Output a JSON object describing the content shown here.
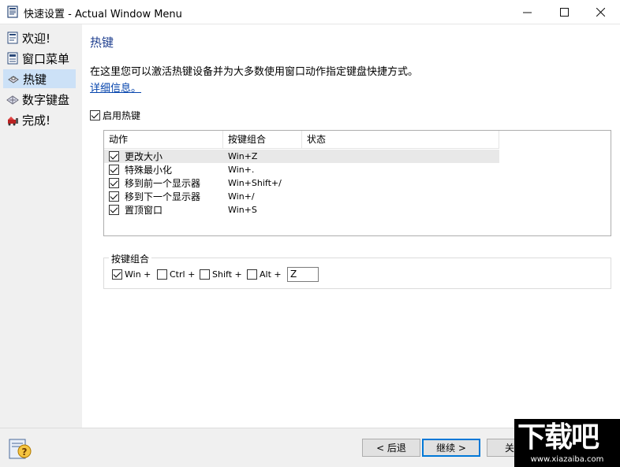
{
  "window": {
    "title": "快速设置 - Actual Window Menu",
    "minimize_glyph": "—",
    "maximize_glyph": "☐",
    "close_glyph": "✕"
  },
  "sidebar": {
    "items": [
      {
        "label": "欢迎!",
        "icon": "page-icon"
      },
      {
        "label": "窗口菜单",
        "icon": "window-icon"
      },
      {
        "label": "热键",
        "icon": "hotkey-icon",
        "active": true
      },
      {
        "label": "数字键盘",
        "icon": "numpad-icon"
      },
      {
        "label": "完成!",
        "icon": "finish-icon"
      }
    ]
  },
  "page": {
    "heading": "热键",
    "description": "在这里您可以激活热键设备并为大多数使用窗口动作指定键盘快捷方式。",
    "link": "详细信息。",
    "enable_label": "启用热键"
  },
  "hotkeys": {
    "columns": [
      "动作",
      "按键组合",
      "状态"
    ],
    "rows": [
      {
        "action": "更改大小",
        "combo": "Win+Z",
        "checked": true
      },
      {
        "action": "特殊最小化",
        "combo": "Win+.",
        "checked": true
      },
      {
        "action": "移到前一个显示器",
        "combo": "Win+Shift+/",
        "checked": true
      },
      {
        "action": "移到下一个显示器",
        "combo": "Win+/",
        "checked": true
      },
      {
        "action": "置顶窗口",
        "combo": "Win+S",
        "checked": true
      }
    ]
  },
  "key_group": {
    "title": "按键组合",
    "win": "Win +",
    "ctrl": "Ctrl +",
    "shift": "Shift +",
    "alt": "Alt +",
    "key_value": "Z"
  },
  "footer": {
    "back": "< 后退",
    "next": "继续 >",
    "close": "关"
  },
  "watermark": {
    "main": "下载吧",
    "url": "www.xiazaiba.com"
  },
  "colors": {
    "accent": "#0078d7",
    "heading": "#1f3f8f",
    "link": "#0645ad",
    "selection": "#cce1f7"
  }
}
